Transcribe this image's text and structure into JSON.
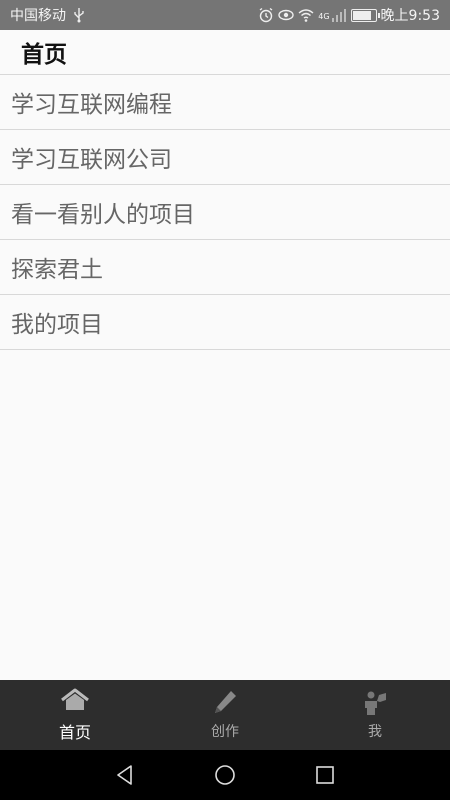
{
  "status_bar": {
    "carrier": "中国移动",
    "network_badge": "4G",
    "time": "晚上9:53",
    "icons": [
      "usb-icon",
      "alarm-icon",
      "eye-icon",
      "wifi-icon",
      "signal-icon",
      "battery-icon"
    ],
    "battery_level": 0.9
  },
  "app_bar": {
    "title": "首页"
  },
  "list": {
    "items": [
      {
        "label": "学习互联网编程"
      },
      {
        "label": "学习互联网公司"
      },
      {
        "label": "看一看别人的项目"
      },
      {
        "label": "探索君土"
      },
      {
        "label": "我的项目"
      }
    ]
  },
  "tab_bar": {
    "tabs": [
      {
        "label": "首页",
        "icon": "home-icon",
        "active": true
      },
      {
        "label": "创作",
        "icon": "pencil-icon",
        "active": false
      },
      {
        "label": "我",
        "icon": "person-icon",
        "active": false
      }
    ]
  },
  "nav_bar": {
    "icons": [
      "back-icon",
      "home-circle-icon",
      "recents-icon"
    ]
  },
  "colors": {
    "status_bar_bg": "#757575",
    "tab_bar_bg": "#2d2d2d",
    "nav_bar_bg": "#000000",
    "list_text": "#666666"
  }
}
